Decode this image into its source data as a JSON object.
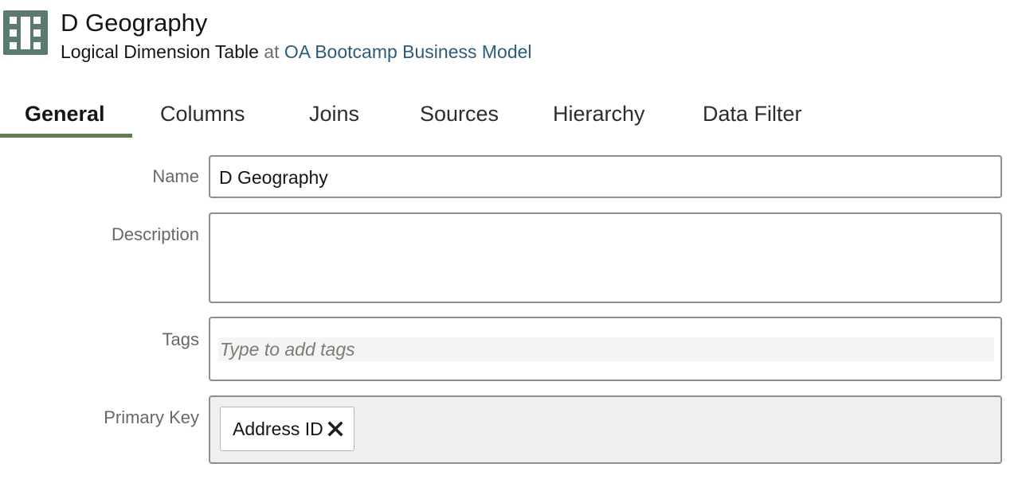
{
  "header": {
    "title": "D Geography",
    "object_type": "Logical Dimension Table",
    "at_word": "at",
    "parent_link": "OA Bootcamp Business Model",
    "icon": "dimension-table-icon"
  },
  "tabs": [
    {
      "label": "General",
      "active": true
    },
    {
      "label": "Columns",
      "active": false
    },
    {
      "label": "Joins",
      "active": false
    },
    {
      "label": "Sources",
      "active": false
    },
    {
      "label": "Hierarchy",
      "active": false
    },
    {
      "label": "Data Filter",
      "active": false
    }
  ],
  "form": {
    "name": {
      "label": "Name",
      "value": "D Geography"
    },
    "description": {
      "label": "Description",
      "value": ""
    },
    "tags": {
      "label": "Tags",
      "placeholder": "Type to add tags"
    },
    "primary_key": {
      "label": "Primary Key",
      "chips": [
        {
          "label": "Address ID",
          "remove_icon": "close-icon"
        }
      ]
    }
  },
  "colors": {
    "accent_underline": "#5f7d4f",
    "icon_bg": "#5a7a72",
    "link": "#2b5c7a"
  }
}
